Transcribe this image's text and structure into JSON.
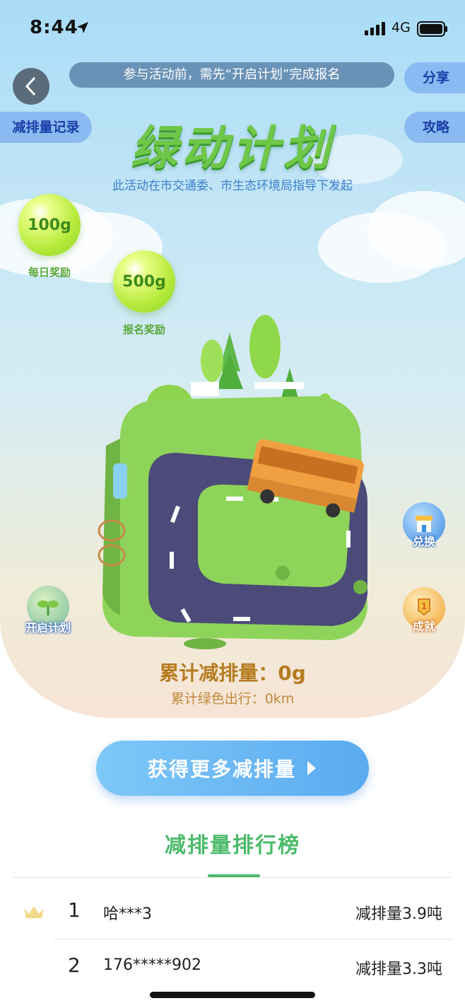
{
  "status_bar": {
    "time": "8:44",
    "network": "4G"
  },
  "header": {
    "notice": "参与活动前，需先“开启计划”完成报名",
    "share_label": "分享",
    "records_label": "减排量记录",
    "guide_label": "攻略"
  },
  "hero": {
    "title": "绿动计划",
    "subtitle": "此活动在市交通委、市生态环境局指导下发起",
    "bubbles": [
      {
        "value": "100g",
        "label": "每日奖励"
      },
      {
        "value": "500g",
        "label": "报名奖励"
      }
    ],
    "start_plan_label": "开启计划",
    "exchange_label": "兑换",
    "achievement_label": "成就",
    "total_reduction": "累计减排量：0g",
    "total_green_trip": "累计绿色出行：0km"
  },
  "cta": {
    "label": "获得更多减排量"
  },
  "ranking": {
    "title": "减排量排行榜",
    "rows": [
      {
        "rank": "1",
        "name": "哈***3",
        "value": "减排量3.9吨"
      },
      {
        "rank": "2",
        "name": "176*****902",
        "value": "减排量3.3吨"
      }
    ]
  },
  "colors": {
    "accent_green": "#4cbb6a",
    "accent_blue": "#5aaaf0",
    "stat_gold": "#b57b20"
  }
}
